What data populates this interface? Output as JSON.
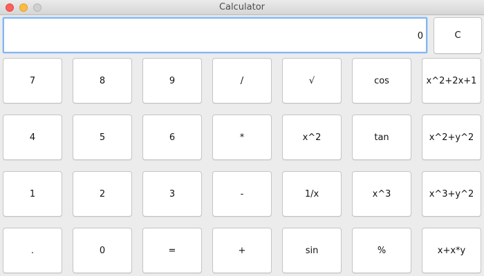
{
  "window": {
    "title": "Calculator"
  },
  "display": {
    "value": "0"
  },
  "clear_label": "C",
  "keypad": [
    [
      "7",
      "8",
      "9",
      "/",
      "√",
      "cos",
      "x^2+2x+1"
    ],
    [
      "4",
      "5",
      "6",
      "*",
      "x^2",
      "tan",
      "x^2+y^2"
    ],
    [
      "1",
      "2",
      "3",
      "-",
      "1/x",
      "x^3",
      "x^3+y^2"
    ],
    [
      ".",
      "0",
      "=",
      "+",
      "sin",
      "%",
      "x+x*y"
    ]
  ],
  "colors": {
    "close": "#fc605c",
    "minimize": "#fdbc40",
    "maximize": "#d0d0d0",
    "focus_ring": "#84b5f2"
  }
}
